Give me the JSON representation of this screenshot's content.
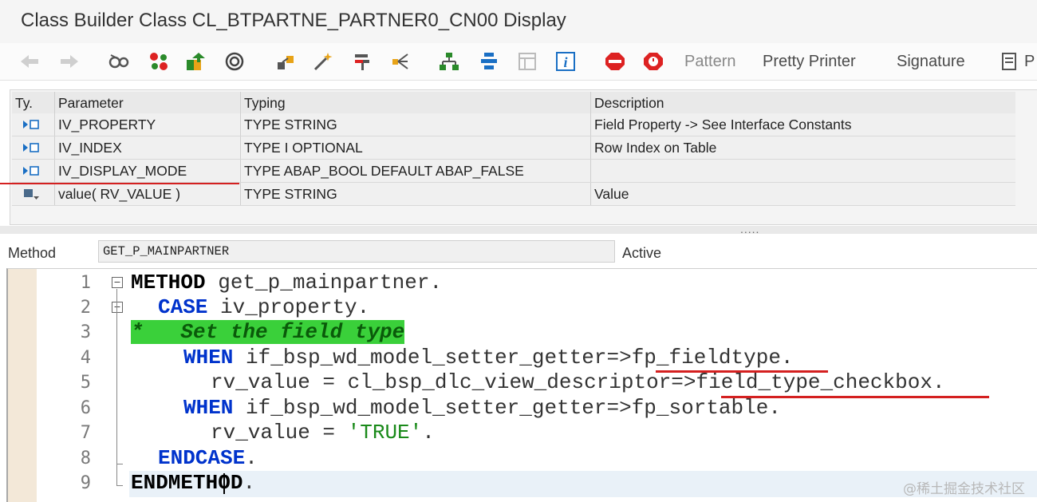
{
  "window": {
    "title": "Class Builder Class CL_BTPARTNE_PARTNER0_CN00 Display"
  },
  "toolbar": {
    "icons": [
      "back-arrow-icon",
      "forward-arrow-icon",
      "glasses-icon",
      "molecule-icon",
      "transport-icon",
      "object-list-icon",
      "hierarchy-icon",
      "magic-wand-icon",
      "where-used-icon",
      "split-icon",
      "org-structure-icon",
      "activate-icon",
      "frame-icon",
      "info-icon",
      "stop-red-icon",
      "stop-watch-icon",
      "print-icon"
    ],
    "pattern_label": "Pattern",
    "pretty_printer_label": "Pretty Printer",
    "signature_label": "Signature",
    "partial_label": "P"
  },
  "params": {
    "headers": {
      "type": "Ty.",
      "parameter": "Parameter",
      "typing": "Typing",
      "description": "Description"
    },
    "rows": [
      {
        "type_icon": "importing-param-icon",
        "parameter": "IV_PROPERTY",
        "typing": "TYPE STRING",
        "description": "Field Property -> See Interface Constants"
      },
      {
        "type_icon": "importing-param-icon",
        "parameter": "IV_INDEX",
        "typing": "TYPE I OPTIONAL",
        "description": "Row Index on Table"
      },
      {
        "type_icon": "importing-param-icon",
        "parameter": "IV_DISPLAY_MODE",
        "typing": "TYPE ABAP_BOOL  DEFAULT ABAP_FALSE",
        "description": ""
      },
      {
        "type_icon": "returning-param-icon",
        "parameter": "value( RV_VALUE )",
        "typing": "TYPE STRING",
        "description": "Value"
      }
    ]
  },
  "splitter": {
    "grip": "....."
  },
  "method": {
    "label": "Method",
    "name": "GET_P_MAINPARTNER",
    "status": "Active"
  },
  "editor": {
    "line_numbers": [
      "1",
      "2",
      "3",
      "4",
      "5",
      "6",
      "7",
      "8",
      "9"
    ],
    "lines": [
      {
        "kw": "METHOD",
        "rest": " get_p_mainpartner."
      },
      {
        "kw": "CASE",
        "rest": " iv_property."
      },
      {
        "comment": "*   Set the field type"
      },
      {
        "kw": "WHEN",
        "rest": " if_bsp_wd_model_setter_getter=>fp_fieldtype."
      },
      {
        "text": "rv_value = cl_bsp_dlc_view_descriptor=>field_type_checkbox."
      },
      {
        "kw": "WHEN",
        "rest": " if_bsp_wd_model_setter_getter=>fp_sortable."
      },
      {
        "text": "rv_value = ",
        "str": "'TRUE'",
        "after": "."
      },
      {
        "kw": "ENDCASE",
        "rest": "."
      },
      {
        "kw": "ENDMETHOD",
        "rest": "."
      }
    ]
  },
  "watermark": "@稀土掘金技术社区",
  "colors": {
    "keyword": "#0033cc",
    "comment_bg": "#3ad03a",
    "string": "#1a8a1a",
    "annotation": "#d42020"
  }
}
